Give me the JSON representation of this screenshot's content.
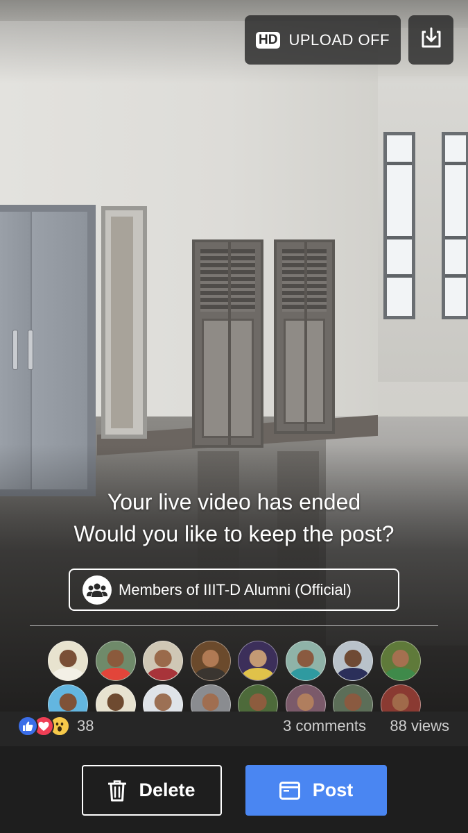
{
  "header": {
    "hd_badge": "HD",
    "upload_label": "UPLOAD OFF",
    "download_icon": "download-icon"
  },
  "ended": {
    "title": "Your live video has ended",
    "subtitle": "Would you like to keep the post?"
  },
  "audience": {
    "icon": "group-icon",
    "label": "Members of IIIT-D Alumni (Official)"
  },
  "viewers": {
    "avatars": [
      {
        "bg": "#e8e3cf",
        "skin": "#7a4f36",
        "shirt": "#f3f0e6"
      },
      {
        "bg": "#6f8a6a",
        "skin": "#8b5a3c",
        "shirt": "#e2453a"
      },
      {
        "bg": "#cfc7b5",
        "skin": "#9a6a4b",
        "shirt": "#a8343a"
      },
      {
        "bg": "#6b4a2c",
        "skin": "#b07a54",
        "shirt": "#3a3530"
      },
      {
        "bg": "#3c2f5a",
        "skin": "#c49a74",
        "shirt": "#e0c24a"
      },
      {
        "bg": "#8fb3a8",
        "skin": "#8a5a40",
        "shirt": "#2f9aa0"
      },
      {
        "bg": "#b9c2ca",
        "skin": "#6f4a34",
        "shirt": "#2b2f5a"
      },
      {
        "bg": "#5f7a3a",
        "skin": "#a57050",
        "shirt": "#3f8a4a"
      },
      {
        "bg": "#63b6e0",
        "skin": "#7f5238",
        "shirt": "#2c3e74"
      },
      {
        "bg": "#e7e2d0",
        "skin": "#6e4a30",
        "shirt": "#2a2a2a"
      },
      {
        "bg": "#dfe3e8",
        "skin": "#9c7054",
        "shirt": "#f2f2f2"
      },
      {
        "bg": "#8a8c90",
        "skin": "#a06e50",
        "shirt": "#e9e9e9"
      },
      {
        "bg": "#4d6a3a",
        "skin": "#8d5c3e",
        "shirt": "#f1ede4"
      },
      {
        "bg": "#7b5a6a",
        "skin": "#b07e5e",
        "shirt": "#c64a6a"
      },
      {
        "bg": "#5c6e58",
        "skin": "#8a5a40",
        "shirt": "#e8e8e8"
      },
      {
        "bg": "#8a3a32",
        "skin": "#a06a4a",
        "shirt": "#26262e"
      }
    ]
  },
  "stats": {
    "reactions": [
      "like-icon",
      "love-icon",
      "wow-icon"
    ],
    "reaction_count": "38",
    "comments": "3 comments",
    "views": "88 views"
  },
  "actions": {
    "delete_label": "Delete",
    "delete_icon": "trash-icon",
    "post_label": "Post",
    "post_icon": "post-icon"
  },
  "colors": {
    "post_button": "#4a86f2",
    "like": "#3b6ee8",
    "love": "#ef3f55",
    "wow": "#f6c94a",
    "bottom_bar": "#1e1e1e"
  }
}
